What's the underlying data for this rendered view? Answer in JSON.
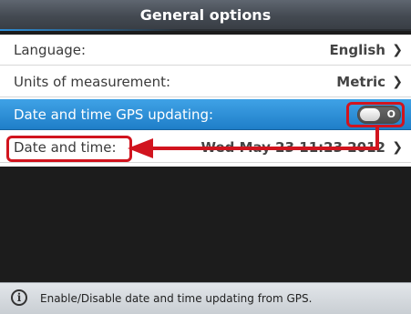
{
  "header": {
    "title": "General options"
  },
  "settings": {
    "rows": [
      {
        "label": "Language:",
        "value": "English",
        "chevron": "❯"
      },
      {
        "label": "Units of measurement:",
        "value": "Metric",
        "chevron": "❯"
      },
      {
        "label": "Date and time GPS updating:",
        "toggle_state": "O",
        "toggle_on": false
      },
      {
        "label": "Date and time:",
        "value": "Wed May 23 11:23 2012",
        "chevron": "❯"
      }
    ]
  },
  "footer": {
    "icon": "info-icon",
    "icon_glyph": "i",
    "text": "Enable/Disable date and time updating from GPS."
  },
  "colors": {
    "selected_row": "#2e8fd8",
    "annotation": "#d1141e",
    "titlebar": "#4a5058"
  }
}
